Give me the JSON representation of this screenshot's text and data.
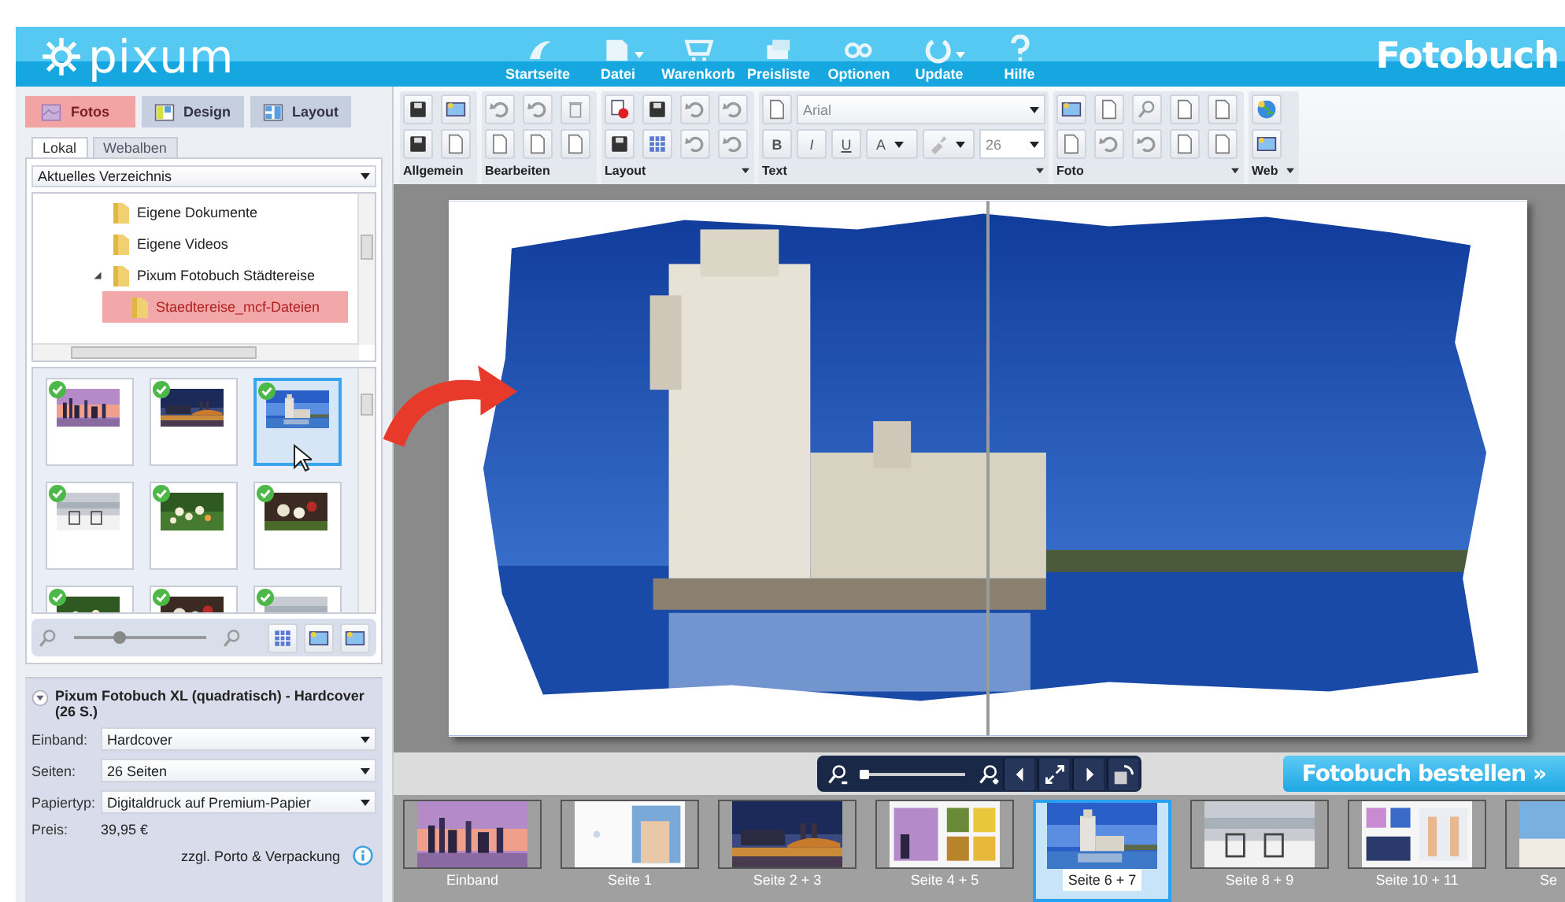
{
  "header": {
    "logo": "pixum",
    "nav": [
      {
        "label": "Startseite",
        "has_menu": false
      },
      {
        "label": "Datei",
        "has_menu": true
      },
      {
        "label": "Warenkorb",
        "has_menu": false
      },
      {
        "label": "Preisliste",
        "has_menu": false
      },
      {
        "label": "Optionen",
        "has_menu": false
      },
      {
        "label": "Update",
        "has_menu": true
      },
      {
        "label": "Hilfe",
        "has_menu": false
      }
    ],
    "title": "Fotobuch"
  },
  "mode_tabs": [
    {
      "label": "Fotos",
      "selected": true
    },
    {
      "label": "Design",
      "selected": false
    },
    {
      "label": "Layout",
      "selected": false
    }
  ],
  "source_tabs": [
    {
      "label": "Lokal",
      "selected": true
    },
    {
      "label": "Webalben",
      "selected": false
    }
  ],
  "folder_select": {
    "value": "Aktuelles Verzeichnis"
  },
  "folder_tree": [
    {
      "label": "Eigene Dokumente",
      "selected": false
    },
    {
      "label": "Eigene Videos",
      "selected": false
    },
    {
      "label": "Pixum Fotobuch Städtereise",
      "selected": false,
      "expanded": true,
      "children": [
        {
          "label": "Staedtereise_mcf-Dateien",
          "selected": true
        }
      ]
    }
  ],
  "photos": [
    {
      "checked": true,
      "selected": false
    },
    {
      "checked": true,
      "selected": false
    },
    {
      "checked": true,
      "selected": true
    },
    {
      "checked": true,
      "selected": false
    },
    {
      "checked": true,
      "selected": false
    },
    {
      "checked": true,
      "selected": false
    },
    {
      "checked": true,
      "selected": false
    },
    {
      "checked": true,
      "selected": false
    },
    {
      "checked": true,
      "selected": false
    }
  ],
  "thumb_zoom": {
    "level": 0.35
  },
  "toolbar": {
    "groups": [
      {
        "label": "Allgemein",
        "has_menu": false
      },
      {
        "label": "Bearbeiten",
        "has_menu": false
      },
      {
        "label": "Layout",
        "has_menu": true
      },
      {
        "label": "Text",
        "has_menu": true
      },
      {
        "label": "Foto",
        "has_menu": true
      },
      {
        "label": "Web",
        "has_menu": true
      }
    ],
    "font": "Arial",
    "font_size": "26",
    "format_buttons": [
      "B",
      "I",
      "U",
      "A"
    ]
  },
  "product": {
    "title": "Pixum Fotobuch XL (quadratisch) - Hardcover (26 S.)",
    "fields": [
      {
        "label": "Einband:",
        "value": "Hardcover"
      },
      {
        "label": "Seiten:",
        "value": "26 Seiten"
      },
      {
        "label": "Papiertyp:",
        "value": "Digitaldruck auf Premium-Papier"
      }
    ],
    "price_label": "Preis:",
    "price": "39,95 €",
    "shipping_note": "zzgl. Porto & Verpackung"
  },
  "page_zoom": {
    "level": 0.05
  },
  "order_button": "Fotobuch bestellen »",
  "pages": [
    {
      "label": "Einband",
      "selected": false
    },
    {
      "label": "Seite 1",
      "selected": false
    },
    {
      "label": "Seite 2 + 3",
      "selected": false
    },
    {
      "label": "Seite 4 + 5",
      "selected": false
    },
    {
      "label": "Seite 6 + 7",
      "selected": true
    },
    {
      "label": "Seite 8 + 9",
      "selected": false
    },
    {
      "label": "Seite 10 + 11",
      "selected": false
    },
    {
      "label": "Se",
      "selected": false
    }
  ]
}
